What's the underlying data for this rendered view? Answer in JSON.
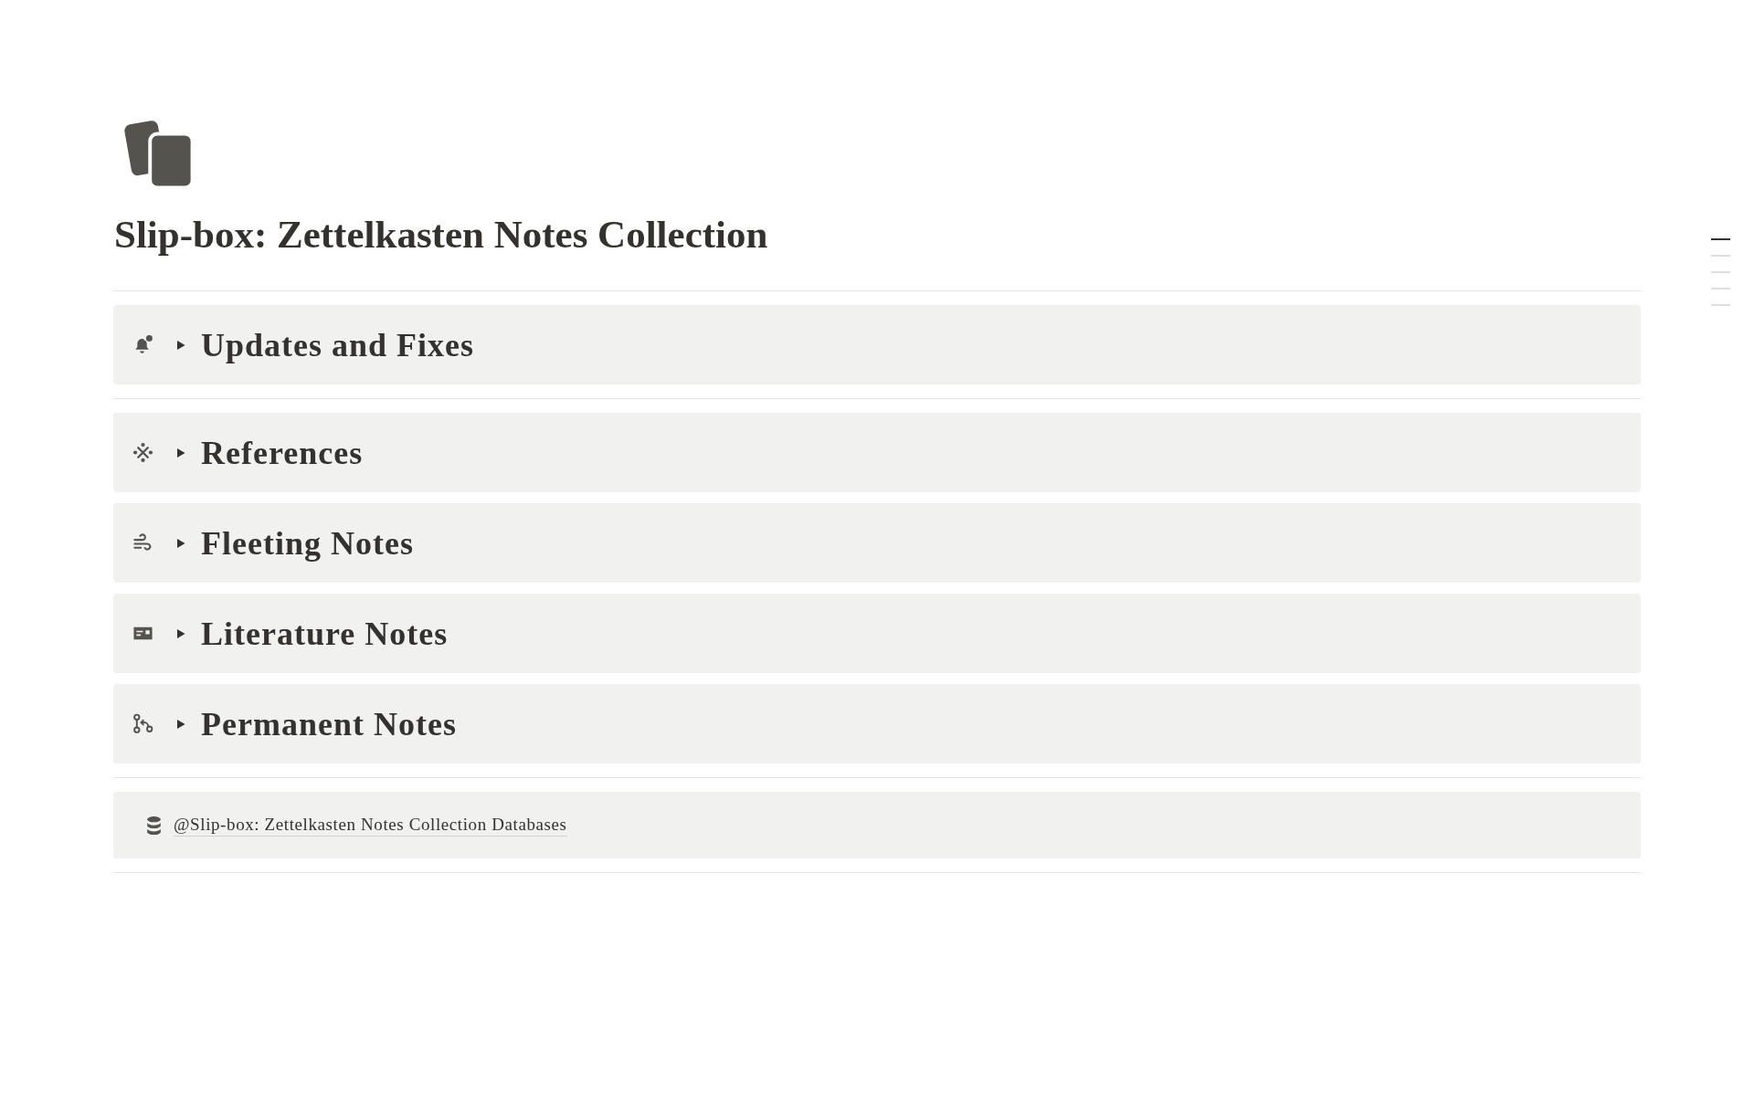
{
  "page": {
    "title": "Slip-box: Zettelkasten Notes Collection"
  },
  "blocks": [
    {
      "kind": "divider"
    },
    {
      "kind": "toggle_heading",
      "title": "Updates and Fixes",
      "expanded": false
    },
    {
      "kind": "divider"
    },
    {
      "kind": "toggle_heading",
      "title": "References",
      "expanded": false
    },
    {
      "kind": "toggle_heading",
      "title": "Fleeting Notes",
      "expanded": false
    },
    {
      "kind": "toggle_heading",
      "title": "Literature Notes",
      "expanded": false
    },
    {
      "kind": "toggle_heading",
      "title": "Permanent Notes",
      "expanded": false
    },
    {
      "kind": "divider"
    },
    {
      "kind": "database_link",
      "text": "@Slip-box: Zettelkasten Notes Collection Databases"
    },
    {
      "kind": "divider"
    }
  ],
  "outline": [
    {
      "selected": true
    },
    {
      "selected": false
    },
    {
      "selected": false
    },
    {
      "selected": false
    },
    {
      "selected": false
    }
  ]
}
